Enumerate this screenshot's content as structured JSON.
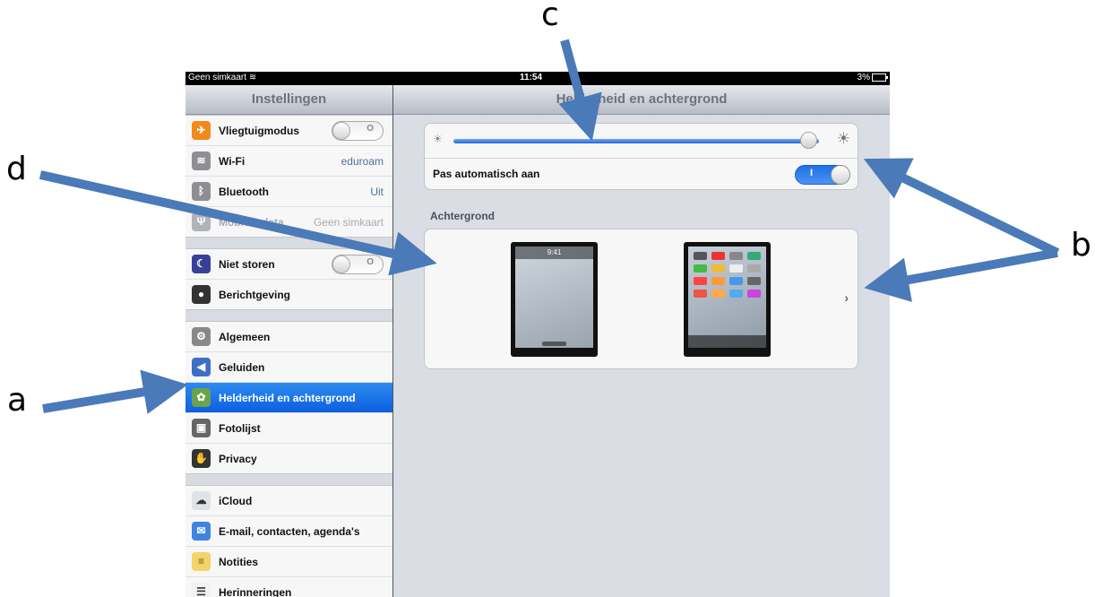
{
  "status_bar": {
    "carrier": "Geen simkaart",
    "time": "11:54",
    "battery": "3%"
  },
  "sidebar": {
    "title": "Instellingen",
    "groups": [
      [
        {
          "label": "Vliegtuigmodus",
          "icon": "airplane-icon",
          "switch": "off"
        },
        {
          "label": "Wi-Fi",
          "icon": "wifi-icon",
          "value": "eduroam"
        },
        {
          "label": "Bluetooth",
          "icon": "bluetooth-icon",
          "value": "Uit"
        },
        {
          "label": "Mobiele data",
          "icon": "antenna-icon",
          "value": "Geen simkaart",
          "dimmed": true
        }
      ],
      [
        {
          "label": "Niet storen",
          "icon": "moon-icon",
          "switch": "off"
        },
        {
          "label": "Berichtgeving",
          "icon": "notifications-icon"
        }
      ],
      [
        {
          "label": "Algemeen",
          "icon": "gear-icon"
        },
        {
          "label": "Geluiden",
          "icon": "speaker-icon"
        },
        {
          "label": "Helderheid en achtergrond",
          "icon": "wallpaper-icon",
          "selected": true
        },
        {
          "label": "Fotolijst",
          "icon": "photo-frame-icon"
        },
        {
          "label": "Privacy",
          "icon": "hand-icon"
        }
      ],
      [
        {
          "label": "iCloud",
          "icon": "cloud-icon"
        },
        {
          "label": "E-mail, contacten, agenda's",
          "icon": "mail-icon"
        },
        {
          "label": "Notities",
          "icon": "notes-icon"
        },
        {
          "label": "Herinneringen",
          "icon": "reminders-icon"
        }
      ]
    ],
    "switch_off_label": "O"
  },
  "main": {
    "title": "Helderheid en achtergrond",
    "brightness": {
      "level": 0.97,
      "auto_label": "Pas automatisch aan",
      "auto_state": "on",
      "switch_on_label": "I"
    },
    "wallpaper_section": "Achtergrond",
    "lock_screen_time": "9:41"
  },
  "annotations": {
    "a": "a",
    "b": "b",
    "c": "c",
    "d": "d"
  },
  "colors": {
    "selection": "#1a73e8",
    "arrow": "#4a7ab8",
    "accent_switch": "#2e7be8"
  }
}
